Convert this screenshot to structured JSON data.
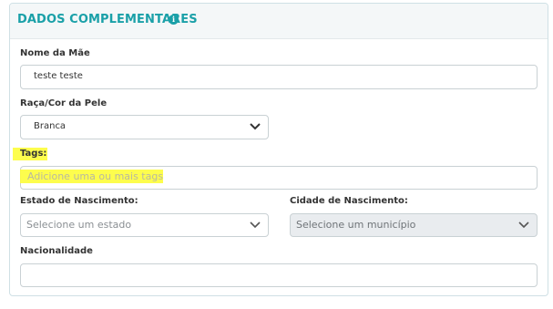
{
  "section": {
    "title": "DADOS COMPLEMENTARES",
    "info_icon": "info-icon"
  },
  "fields": {
    "mother_name": {
      "label": "Nome da Mãe",
      "value": "teste teste"
    },
    "race": {
      "label": "Raça/Cor da Pele",
      "value": "Branca"
    },
    "tags": {
      "label": "Tags:",
      "placeholder": "Adicione uma ou mais tags"
    },
    "birth_state": {
      "label": "Estado de Nascimento:",
      "placeholder": "Selecione um estado"
    },
    "birth_city": {
      "label": "Cidade de Nascimento:",
      "placeholder": "Selecione um município"
    },
    "nationality": {
      "label": "Nacionalidade",
      "value": ""
    }
  },
  "colors": {
    "accent": "#1aa0a8",
    "highlight": "#fdfd3a",
    "border": "#c9d1d4",
    "disabled_bg": "#e9ecef"
  }
}
